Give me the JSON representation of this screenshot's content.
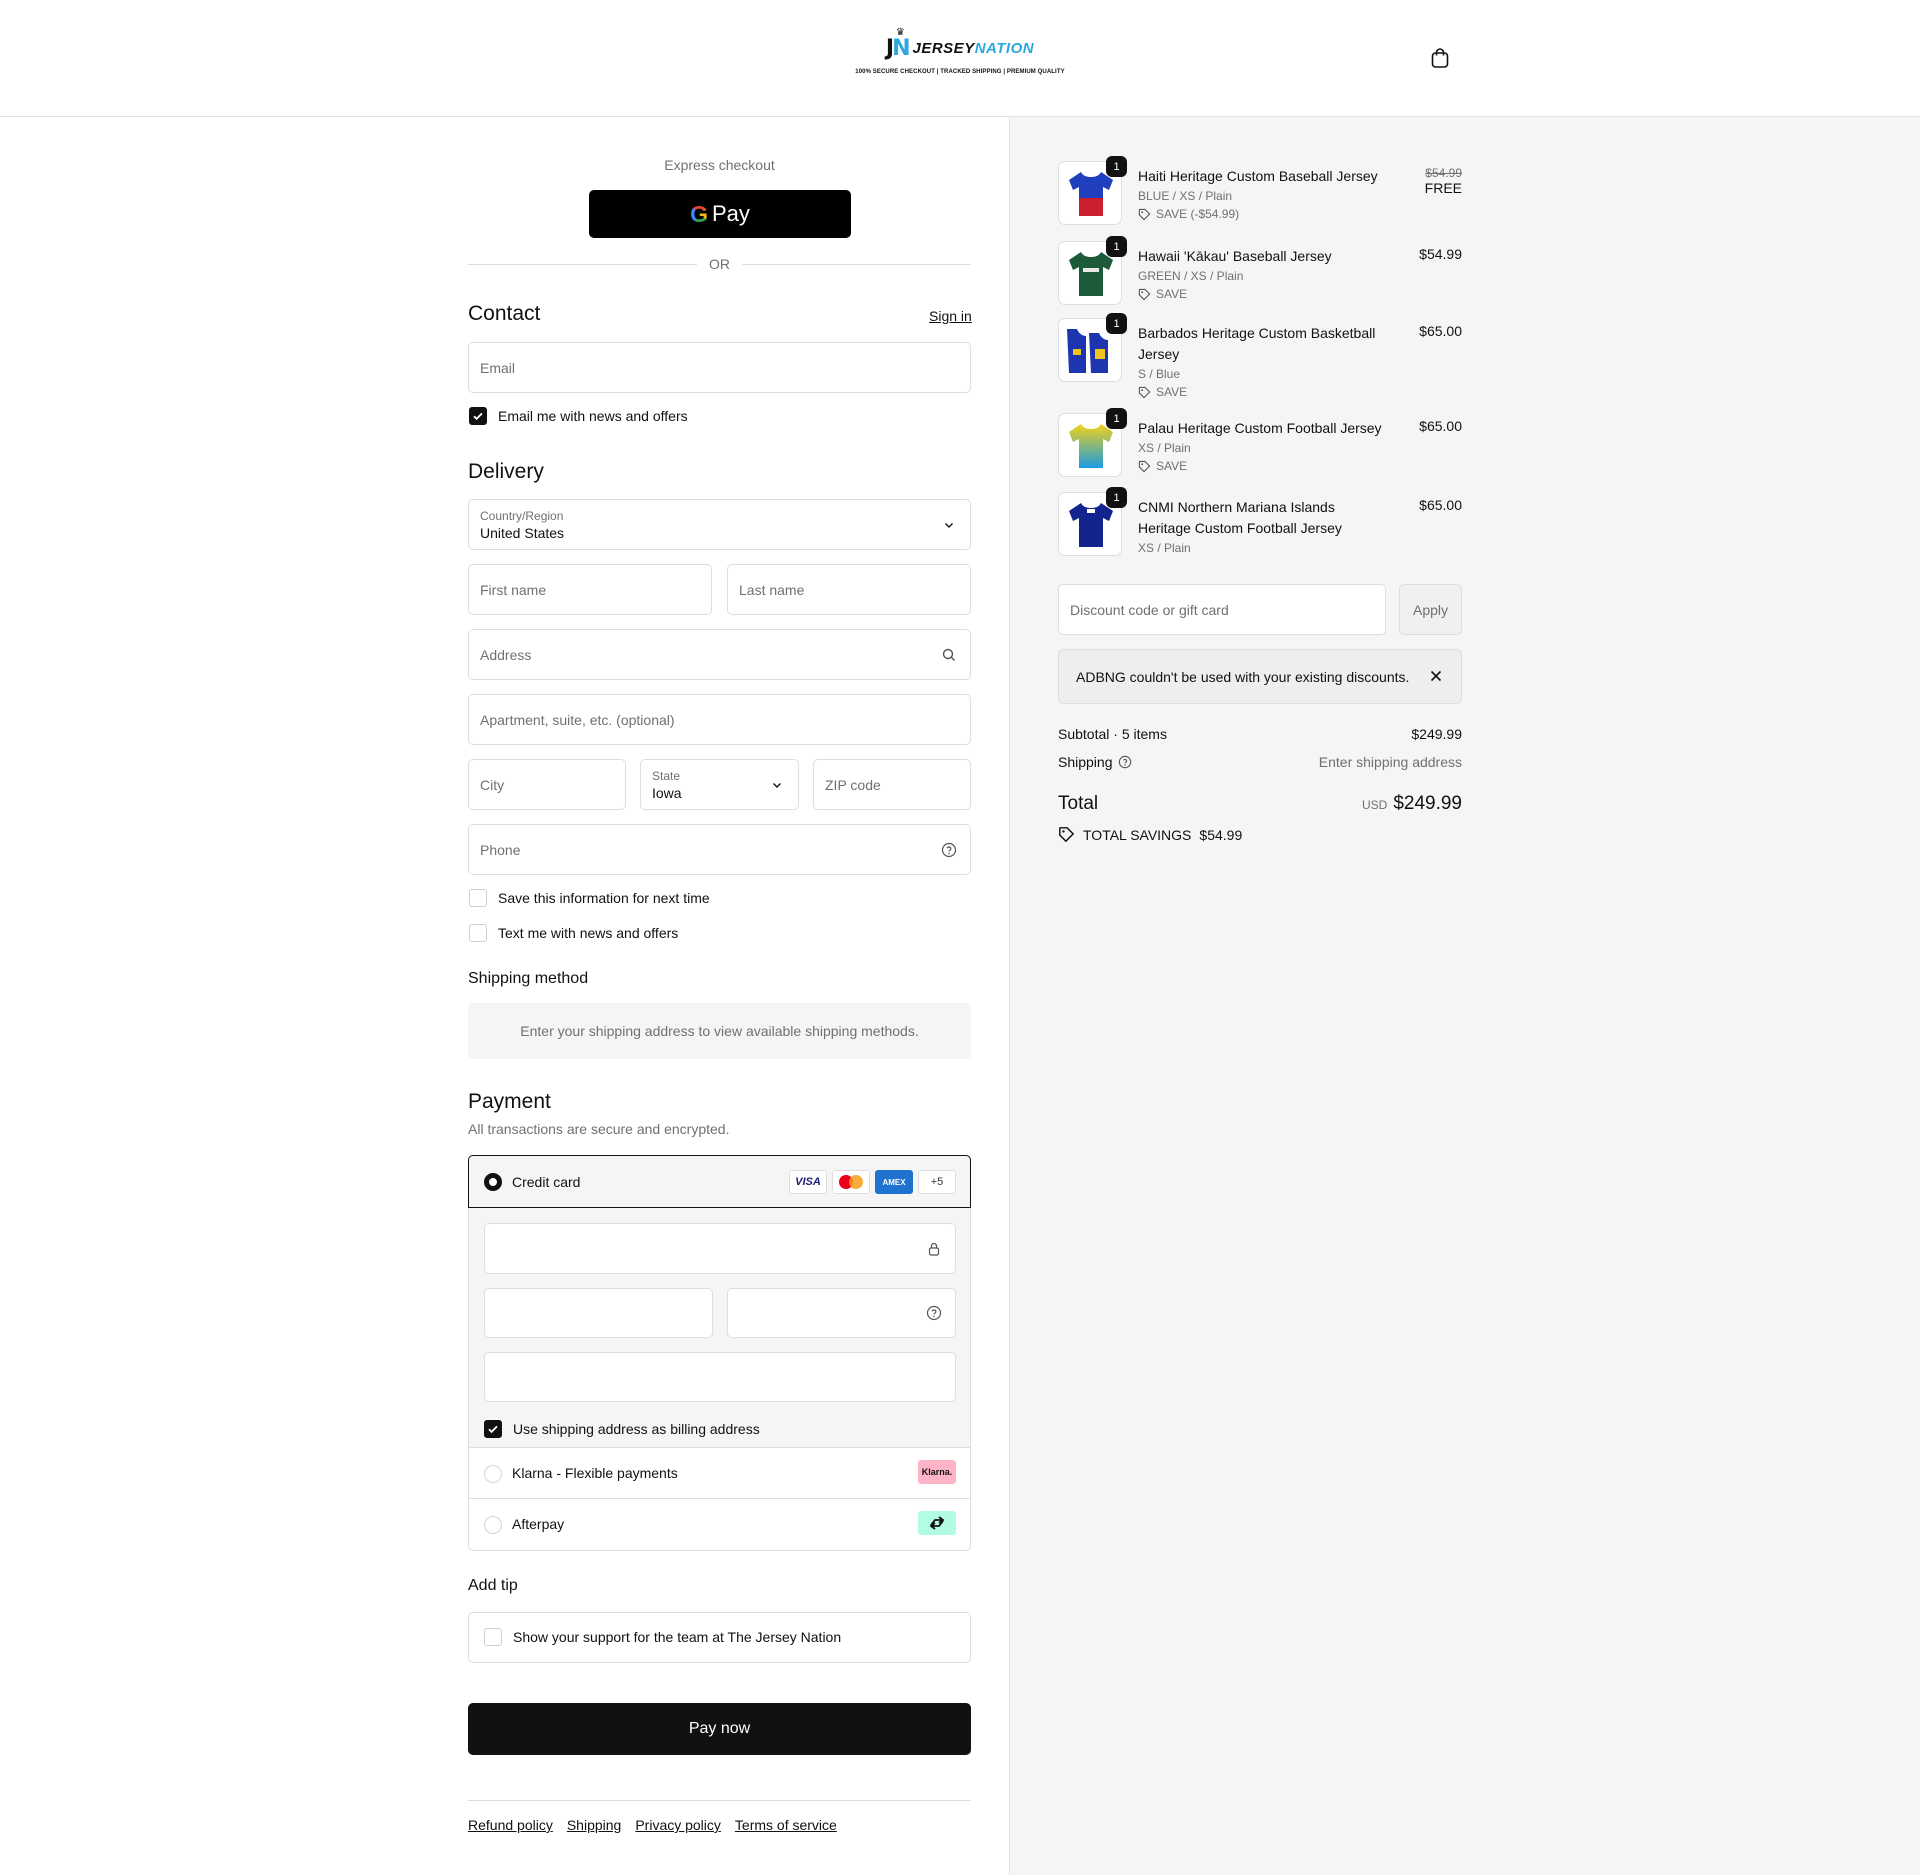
{
  "header": {
    "logo_mark_j": "J",
    "logo_mark_n": "N",
    "logo_word_a": "JERSEY",
    "logo_word_b": "NATION",
    "logo_tagline": "100% SECURE CHECKOUT  |  TRACKED SHIPPING  |  PREMIUM QUALITY",
    "cart_icon": "shopping-bag-icon"
  },
  "express": {
    "title": "Express checkout",
    "gpay_g": "G",
    "gpay_label": "Pay",
    "or_label": "OR"
  },
  "contact": {
    "title": "Contact",
    "sign_in": "Sign in",
    "email_placeholder": "Email",
    "email_offers": "Email me with news and offers",
    "email_offers_checked": true
  },
  "delivery": {
    "title": "Delivery",
    "country_label": "Country/Region",
    "country_value": "United States",
    "first_name": "First name",
    "last_name": "Last name",
    "address": "Address",
    "apartment": "Apartment, suite, etc. (optional)",
    "city": "City",
    "state_label": "State",
    "state_value": "Iowa",
    "zip": "ZIP code",
    "phone": "Phone",
    "save_info": "Save this information for next time",
    "text_offers": "Text me with news and offers"
  },
  "shipping_method": {
    "title": "Shipping method",
    "message": "Enter your shipping address to view available shipping methods."
  },
  "payment": {
    "title": "Payment",
    "subtitle": "All transactions are secure and encrypted.",
    "credit_card": "Credit card",
    "card_visa": "VISA",
    "card_amex": "AMEX",
    "card_more": "+5",
    "billing_same": "Use shipping address as billing address",
    "klarna": "Klarna - Flexible payments",
    "klarna_badge": "Klarna.",
    "afterpay": "Afterpay"
  },
  "tip": {
    "title": "Add tip",
    "option": "Show your support for the team at The Jersey Nation"
  },
  "pay_now": "Pay now",
  "footer": {
    "links": [
      "Refund policy",
      "Shipping",
      "Privacy policy",
      "Terms of service"
    ]
  },
  "order": {
    "items": [
      {
        "qty": "1",
        "name": "Haiti Heritage Custom Baseball Jersey",
        "variant": "BLUE / XS / Plain",
        "save": "SAVE (-$54.99)",
        "original_price": "$54.99",
        "price": "FREE",
        "colors": [
          "#1f3fbf",
          "#cc1f2d"
        ]
      },
      {
        "qty": "1",
        "name": "Hawaii 'Kākau' Baseball Jersey",
        "variant": "GREEN / XS / Plain",
        "save": "SAVE",
        "price": "$54.99",
        "colors": [
          "#1d5a3a",
          "#1d5a3a"
        ]
      },
      {
        "qty": "1",
        "name": "Barbados Heritage Custom Basketball Jersey",
        "variant": "S / Blue",
        "save": "SAVE",
        "price": "$65.00",
        "colors": [
          "#1e35b0",
          "#f2c31b"
        ]
      },
      {
        "qty": "1",
        "name": "Palau Heritage Custom Football Jersey",
        "variant": "XS / Plain",
        "save": "SAVE",
        "price": "$65.00",
        "colors": [
          "#f3d21a",
          "#1a9be0"
        ]
      },
      {
        "qty": "1",
        "name": "CNMI Northern Mariana Islands Heritage Custom Football Jersey",
        "variant": "XS / Plain",
        "price": "$65.00",
        "colors": [
          "#14248f",
          "#14248f"
        ]
      }
    ],
    "discount_placeholder": "Discount code or gift card",
    "apply": "Apply",
    "notice": "ADBNG couldn't be used with your existing discounts.",
    "subtotal_label": "Subtotal · 5 items",
    "subtotal_value": "$249.99",
    "shipping_label": "Shipping",
    "shipping_value": "Enter shipping address",
    "total_label": "Total",
    "total_currency": "USD",
    "total_value": "$249.99",
    "savings_label": "TOTAL SAVINGS",
    "savings_value": "$54.99"
  }
}
